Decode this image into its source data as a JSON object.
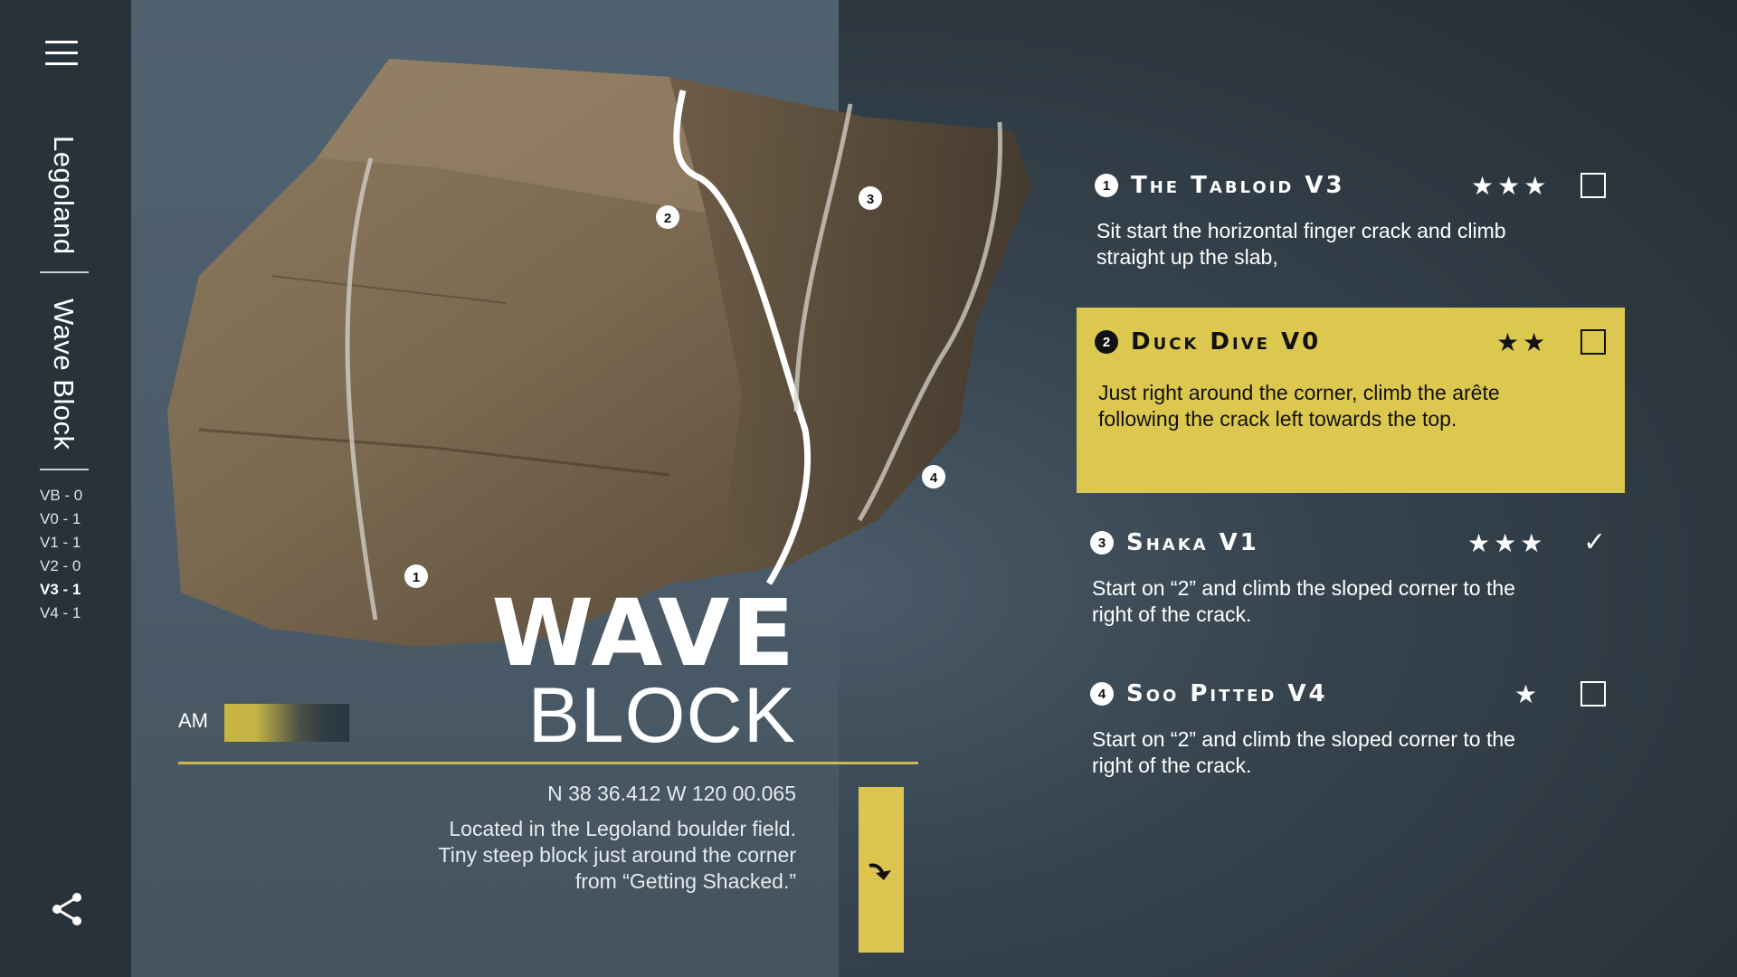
{
  "sidebar": {
    "crumbs": [
      "Legoland",
      "Wave Block"
    ],
    "grades": [
      "VB - 0",
      "V0 - 1",
      "V1 - 1",
      "V2 - 0",
      "V3 - 1",
      "V4 - 1"
    ],
    "highlighted_grade": "V3 - 1"
  },
  "boulder": {
    "title_top": "WAVE",
    "title_bottom": "BLOCK",
    "am_label": "AM",
    "coordinates": "N 38 36.412 W 120 00.065",
    "description": "Located in the Legoland boulder field. Tiny steep block just around the corner from “Getting Shacked.”",
    "route_markers": [
      "1",
      "2",
      "3",
      "4"
    ]
  },
  "routes": [
    {
      "number": "1",
      "name": "The Tabloid V3",
      "stars": "★★★",
      "rating": 3,
      "status": "unchecked",
      "description": "Sit start the horizontal finger crack and climb straight up the slab,"
    },
    {
      "number": "2",
      "name": "Duck Dive V0",
      "stars": "★★",
      "rating": 2,
      "status": "unchecked",
      "active": true,
      "description": "Just right around the corner, climb the arête following the crack left towards the top."
    },
    {
      "number": "3",
      "name": "Shaka V1",
      "stars": "★★★",
      "rating": 3,
      "status": "checked",
      "checkmark": "✓",
      "description": "Start on “2” and climb the sloped corner to the right of the crack."
    },
    {
      "number": "4",
      "name": "Soo Pitted V4",
      "stars": "★",
      "rating": 1,
      "status": "unchecked",
      "description": "Start on “2” and climb the sloped corner to the right of the crack."
    }
  ],
  "colors": {
    "accent": "#dcc84f",
    "sidebar": "#27323a",
    "panel": "#4b5b69"
  },
  "icons": {
    "menu": "hamburger-icon",
    "share": "share-icon",
    "go": "curved-arrow-icon"
  }
}
